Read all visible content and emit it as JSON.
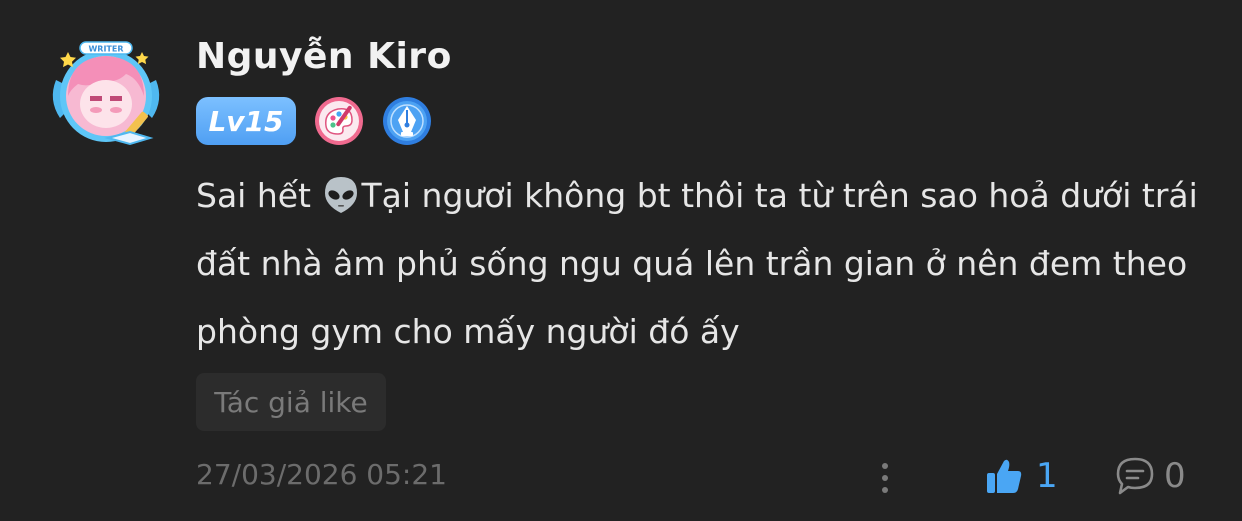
{
  "comment": {
    "username": "Nguyễn Kiro",
    "level_badge": "Lv15",
    "avatar_frame_label": "WRITER",
    "text_before_emoji": "Sai hết ",
    "emoji": "alien-emoji",
    "text_after_emoji": "Tại ngươi không bt thôi ta từ trên sao hoả dưới trái đất nhà âm phủ sống ngu quá lên trần gian ở nên đem theo phòng gym cho mấy người đó ấy",
    "author_like_label": "Tác giả like",
    "timestamp": "27/03/2026 05:21",
    "like_count": "1",
    "reply_count": "0"
  },
  "colors": {
    "background": "#222222",
    "accent_blue": "#4aa6f4",
    "level_badge": "#5aa8f5",
    "muted_text": "#6c6c6c"
  },
  "icons": {
    "badge_1": "palette-badge-icon",
    "badge_2": "pen-nib-badge-icon",
    "more": "more-vertical-icon",
    "like": "thumbs-up-icon",
    "reply": "comment-bubble-icon"
  }
}
